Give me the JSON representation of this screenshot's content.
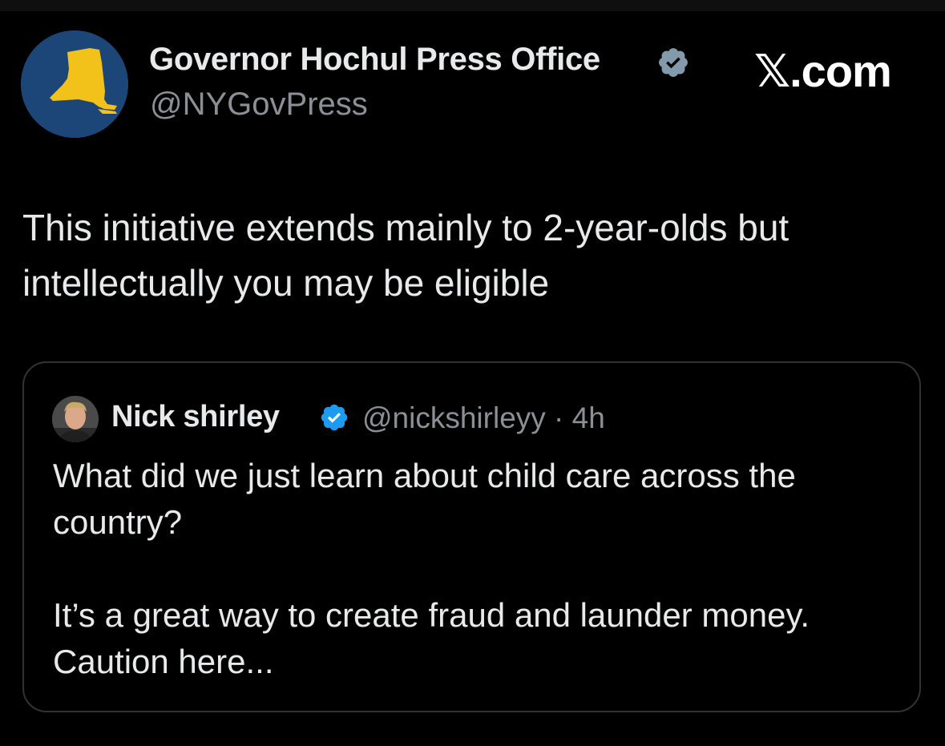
{
  "post": {
    "author": {
      "name": "Governor Hochul Press Office",
      "handle": "@NYGovPress",
      "avatar_icon": "new-york-state-map-icon",
      "verified_badge_icon": "gray-verified-badge-icon",
      "badge_color": "#829aab"
    },
    "watermark": "𝕏.com",
    "text_lines": [
      "This initiative extends mainly to 2-year-olds but",
      "intellectually you may be eligible"
    ]
  },
  "quoted_post": {
    "author": {
      "name": "Nick shirley",
      "avatar_icon": "profile-photo-avatar",
      "verified_badge_icon": "blue-verified-badge-icon",
      "badge_color": "#1d9bf0"
    },
    "meta": "@nickshirleyy · 4h",
    "paragraph1_lines": [
      "What did we just learn about child care across the",
      "country?"
    ],
    "paragraph2_lines": [
      "It’s a great way to create fraud and launder money.",
      "Caution here..."
    ]
  },
  "colors": {
    "background": "#000000",
    "text_primary": "#e7e9ea",
    "text_secondary": "#8b9096",
    "card_border": "#2f3336",
    "avatar_bg": "#1d4678",
    "state_map": "#f2c21b"
  }
}
